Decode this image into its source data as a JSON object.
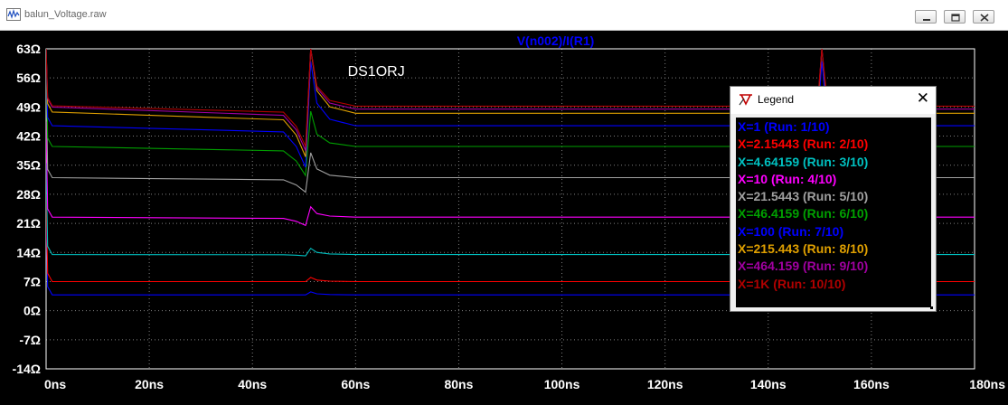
{
  "window": {
    "title": "balun_Voltage.raw",
    "minimize_glyph": "—",
    "restore_glyph": "❐",
    "close_glyph": "✕"
  },
  "legend": {
    "title": "Legend",
    "close_glyph": "✕",
    "items": [
      {
        "label": "X=1  (Run: 1/10)",
        "color": "#0000ff"
      },
      {
        "label": "X=2.15443  (Run: 2/10)",
        "color": "#ff0000"
      },
      {
        "label": "X=4.64159  (Run: 3/10)",
        "color": "#00c0c0"
      },
      {
        "label": "X=10  (Run: 4/10)",
        "color": "#ff00ff"
      },
      {
        "label": "X=21.5443  (Run: 5/10)",
        "color": "#a0a0a0"
      },
      {
        "label": "X=46.4159  (Run: 6/10)",
        "color": "#00a000"
      },
      {
        "label": "X=100  (Run: 7/10)",
        "color": "#0000ff"
      },
      {
        "label": "X=215.443  (Run: 8/10)",
        "color": "#e0a000"
      },
      {
        "label": "X=464.159  (Run: 9/10)",
        "color": "#a000a0"
      },
      {
        "label": "X=1K  (Run: 10/10)",
        "color": "#b00000"
      }
    ]
  },
  "chart_data": {
    "type": "line",
    "title": "V(n002)/I(R1)",
    "annotation": "DS1ORJ",
    "x_ticks": [
      "0ns",
      "20ns",
      "40ns",
      "60ns",
      "80ns",
      "100ns",
      "120ns",
      "140ns",
      "160ns",
      "180ns"
    ],
    "y_ticks": [
      "63Ω",
      "56Ω",
      "49Ω",
      "42Ω",
      "35Ω",
      "28Ω",
      "21Ω",
      "14Ω",
      "7Ω",
      "0Ω",
      "-7Ω",
      "-14Ω"
    ],
    "xlim": [
      0,
      180
    ],
    "ylim": [
      -14,
      63
    ],
    "x_unit": "ns",
    "y_unit": "Ω",
    "grid": true,
    "legend_placement": "right",
    "colors": {
      "background": "#000000",
      "grid": "#7f7f7f",
      "axis": "#ffffff",
      "title": "#0000ff"
    },
    "series": [
      {
        "name": "X=1  (Run: 1/10)",
        "color": "#0000ff",
        "plateau": 3.8,
        "early": 3.8,
        "dip": 3.8,
        "spike": 4.5
      },
      {
        "name": "X=2.15443  (Run: 2/10)",
        "color": "#ff0000",
        "plateau": 7.0,
        "early": 7.0,
        "dip": 7.0,
        "spike": 8.0
      },
      {
        "name": "X=4.64159  (Run: 3/10)",
        "color": "#00c0c0",
        "plateau": 13.5,
        "early": 13.5,
        "dip": 13.2,
        "spike": 15.0
      },
      {
        "name": "X=10  (Run: 4/10)",
        "color": "#ff00ff",
        "plateau": 22.5,
        "early": 22.5,
        "dip": 20.5,
        "spike": 25.0
      },
      {
        "name": "X=21.5443  (Run: 5/10)",
        "color": "#a0a0a0",
        "plateau": 32.0,
        "early": 32.0,
        "dip": 28.5,
        "spike": 38.0
      },
      {
        "name": "X=46.4159  (Run: 6/10)",
        "color": "#00a000",
        "plateau": 39.5,
        "early": 39.5,
        "dip": 32.5,
        "spike": 48.0
      },
      {
        "name": "X=100  (Run: 7/10)",
        "color": "#0000ff",
        "plateau": 44.5,
        "early": 44.5,
        "dip": 34.5,
        "spike": 60.0
      },
      {
        "name": "X=215.443  (Run: 8/10)",
        "color": "#e0a000",
        "plateau": 47.5,
        "early": 47.8,
        "dip": 37.0,
        "spike": 63.0
      },
      {
        "name": "X=464.159  (Run: 9/10)",
        "color": "#a000a0",
        "plateau": 48.5,
        "early": 49.0,
        "dip": 38.5,
        "spike": 63.0
      },
      {
        "name": "X=1K  (Run: 10/10)",
        "color": "#b00000",
        "plateau": 49.2,
        "early": 49.3,
        "dip": 39.5,
        "spike": 63.0
      }
    ]
  }
}
